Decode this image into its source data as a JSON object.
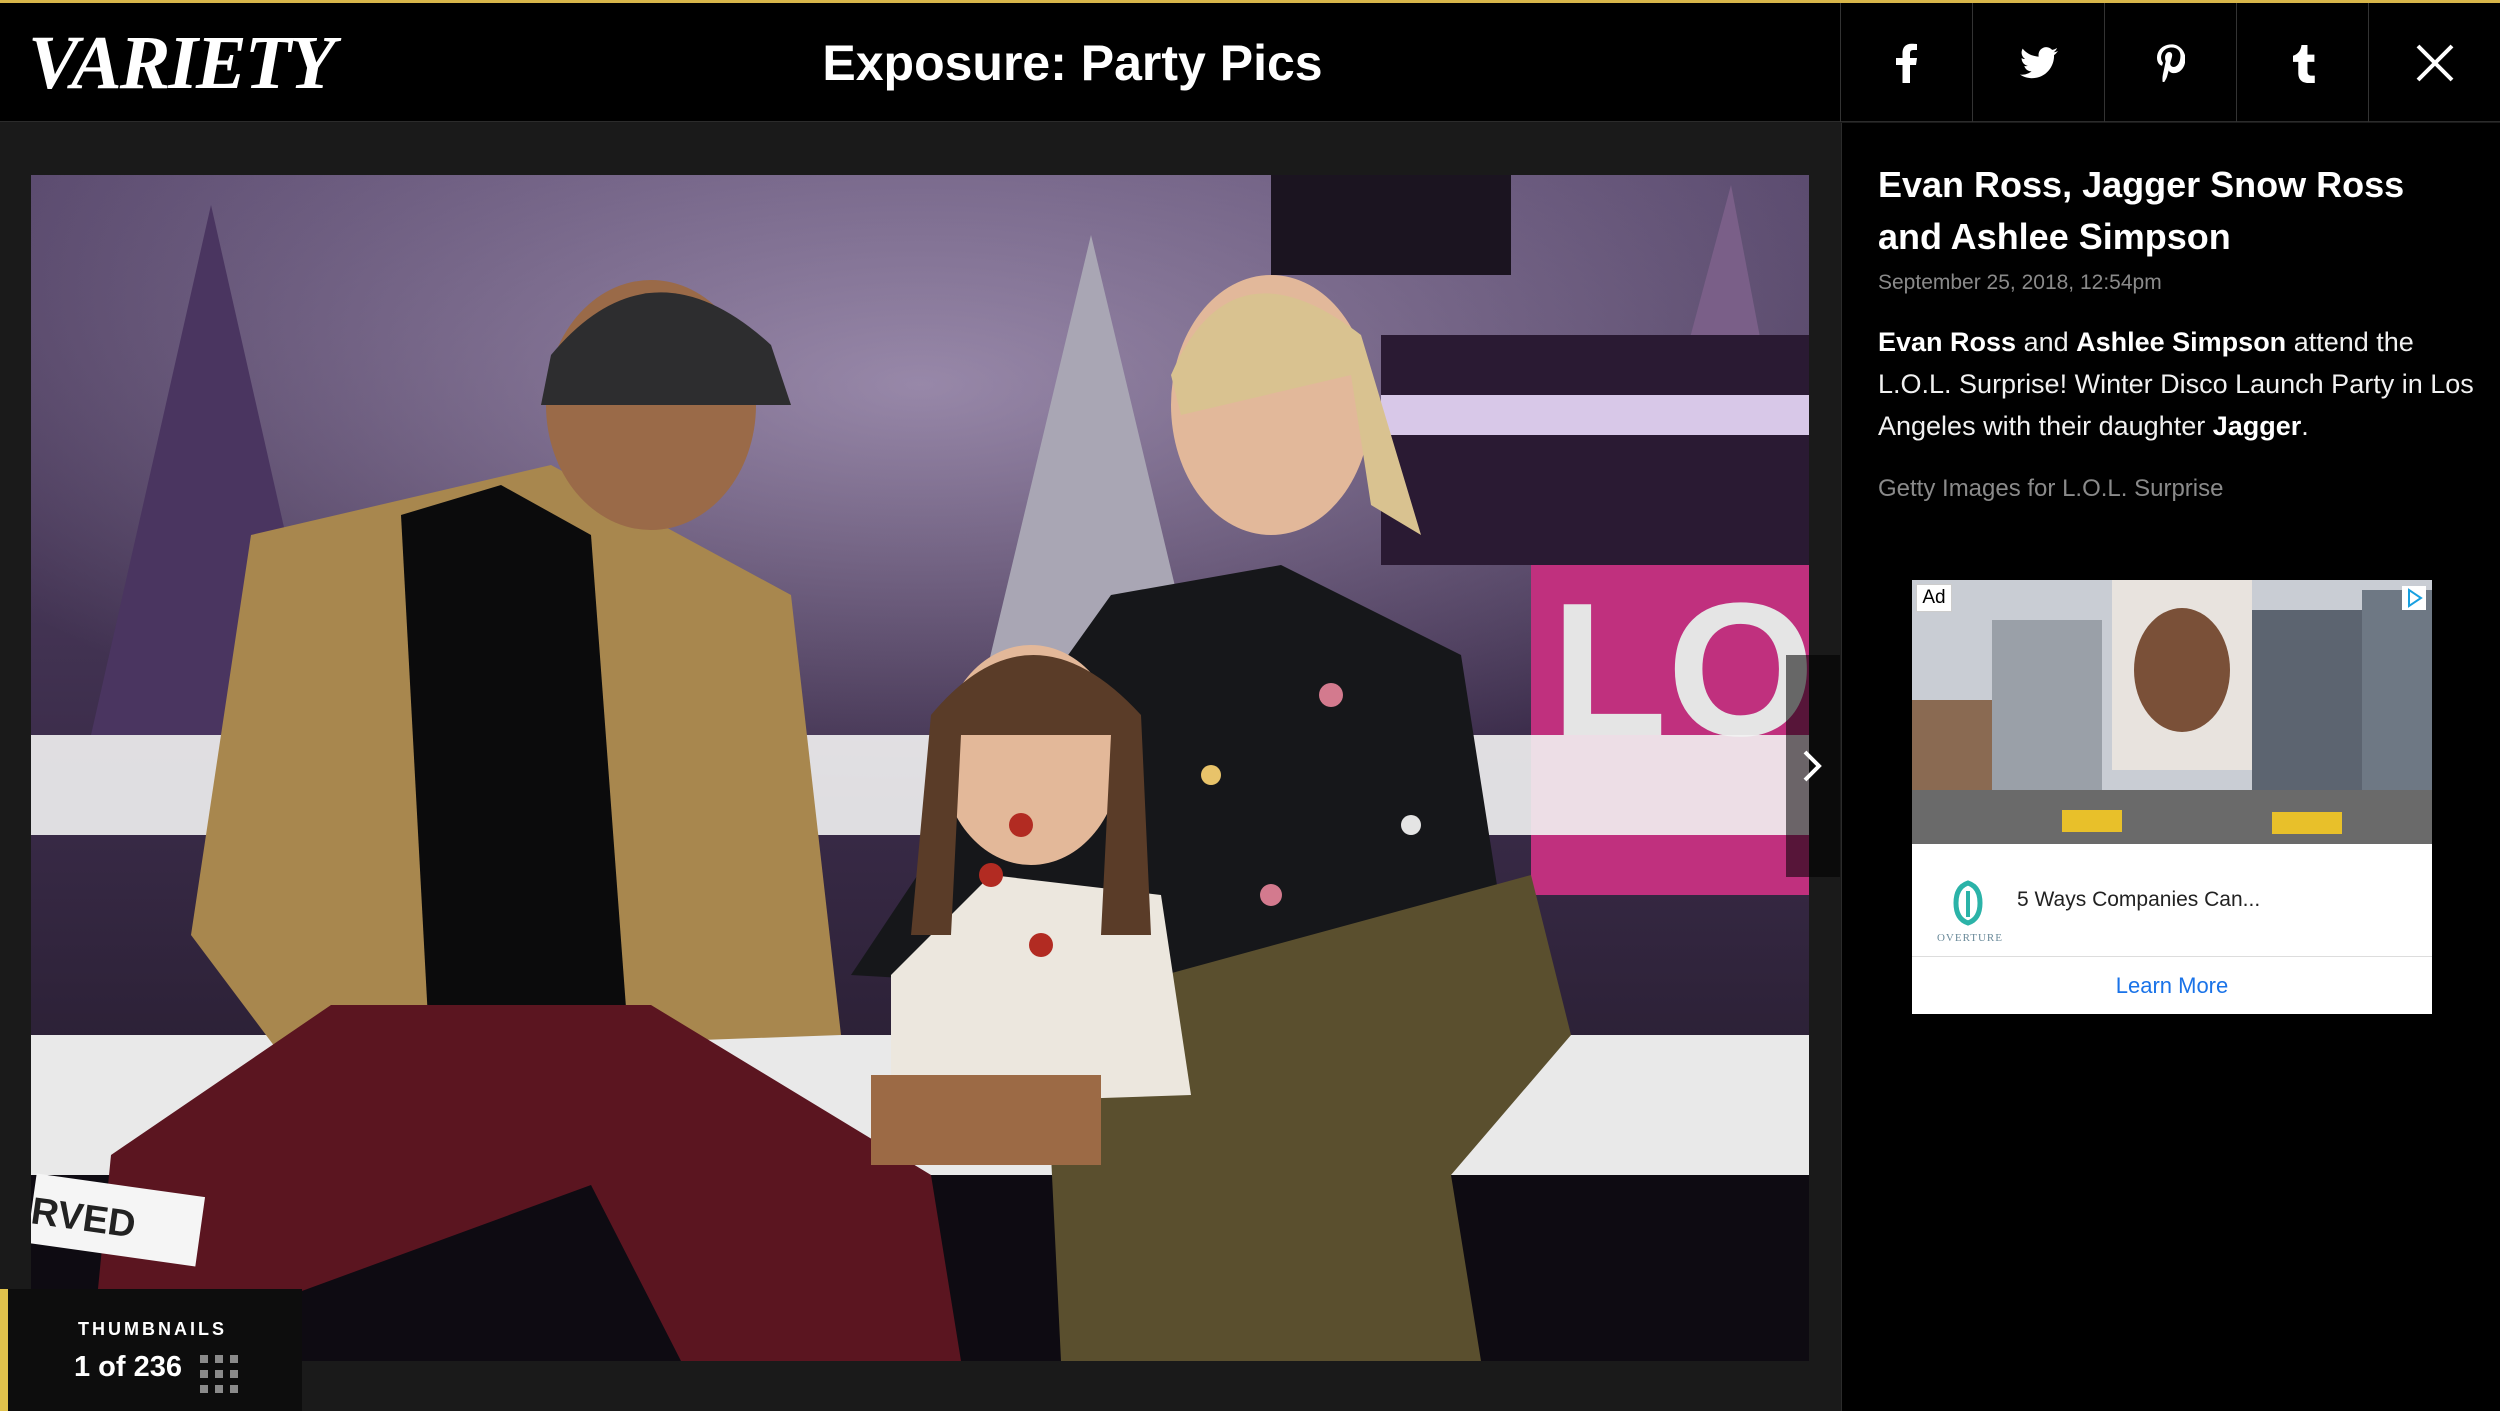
{
  "header": {
    "logo_text": "VARIETY",
    "title": "Exposure: Party Pics",
    "share_icons": [
      "facebook-icon",
      "twitter-icon",
      "pinterest-icon",
      "tumblr-icon"
    ],
    "close_icon": "close-icon"
  },
  "gallery": {
    "thumbnails_label": "THUMBNAILS",
    "counter": "1 of 236",
    "next_icon": "chevron-right-icon"
  },
  "caption": {
    "title": "Evan Ross, Jagger Snow Ross and Ashlee Simpson",
    "date": "September 25, 2018, 12:54pm",
    "body": {
      "name1": "Evan Ross",
      "t1": " and ",
      "name2": "Ashlee Simpson",
      "t2": " attend the L.O.L. Surprise! Winter Disco Launch Party in Los Angeles with their daughter ",
      "name3": "Jagger",
      "t3": "."
    },
    "credit": "Getty Images for L.O.L. Surprise"
  },
  "ad": {
    "badge": "Ad",
    "advertiser": "OVERTURE",
    "headline": "5 Ways Companies Can...",
    "cta": "Learn More"
  },
  "colors": {
    "accent": "#e0c24c",
    "header_bg": "#000000",
    "stage_bg": "#1a1a1a",
    "link": "#1a73e8"
  }
}
